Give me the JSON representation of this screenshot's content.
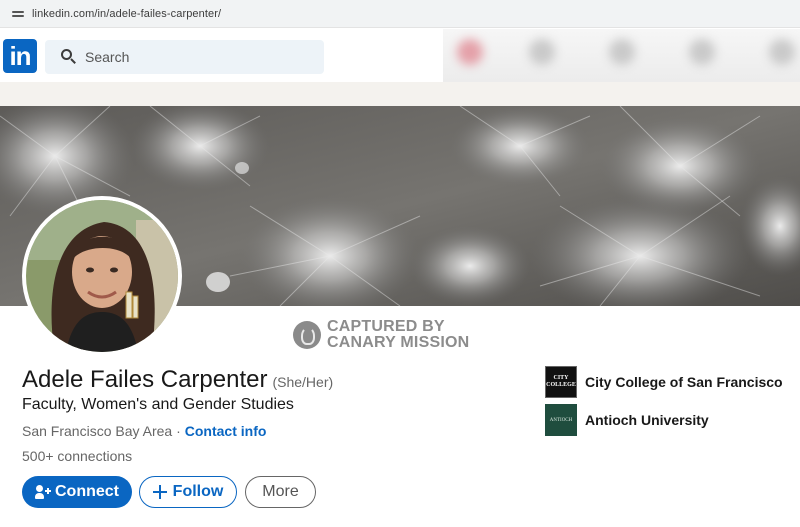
{
  "browser": {
    "url": "linkedin.com/in/adele-failes-carpenter/"
  },
  "header": {
    "logo_text": "in",
    "search_placeholder": "Search"
  },
  "watermark": {
    "line1": "CAPTURED BY",
    "line2": "CANARY MISSION"
  },
  "profile": {
    "name": "Adele Failes Carpenter",
    "pronouns": "(She/Her)",
    "headline": "Faculty, Women's and Gender Studies",
    "location": "San Francisco Bay Area ·",
    "contact_info": "Contact info",
    "connections": "500+ connections"
  },
  "actions": {
    "connect": "Connect",
    "follow": "Follow",
    "more": "More"
  },
  "education": [
    {
      "name": "City College of San Francisco",
      "logo_text": [
        "CITY",
        "COLLEGE"
      ]
    },
    {
      "name": "Antioch University",
      "logo_text": [
        "ANTIOCH"
      ]
    }
  ],
  "colors": {
    "brand": "#0a66c2",
    "text_primary": "#191919",
    "text_secondary": "#666666",
    "search_bg": "#edf3f8"
  }
}
